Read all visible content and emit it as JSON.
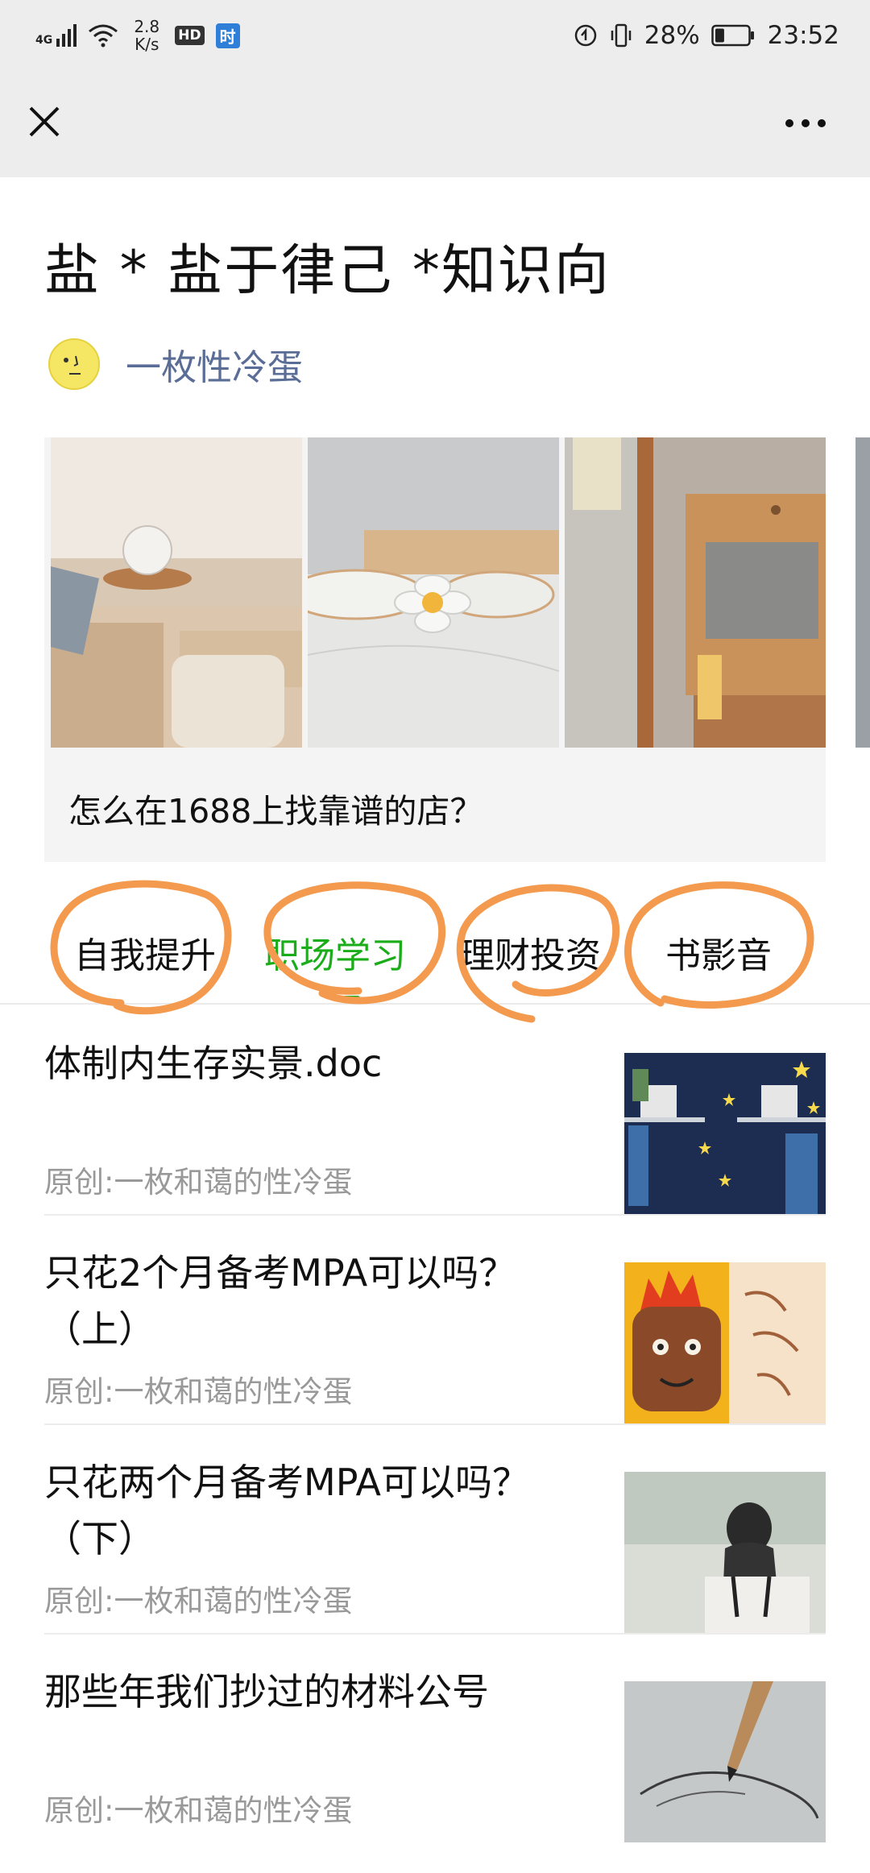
{
  "status_bar": {
    "signal": "4G",
    "net_speed_value": "2.8",
    "net_speed_unit": "K/s",
    "hd_badge": "HD",
    "app_badge": "时",
    "battery": "28%",
    "time": "23:52",
    "battery_level": 0.28
  },
  "nav": {
    "close_icon": "close-icon",
    "more_icon": "more-icon"
  },
  "page": {
    "title": "盐 * 盐于律己 *知识向",
    "author": "一枚性冷蛋"
  },
  "featured": {
    "caption": "怎么在1688上找靠谱的店？"
  },
  "tabs": [
    {
      "label": "自我提升",
      "active": false
    },
    {
      "label": "职场学习",
      "active": true
    },
    {
      "label": "理财投资",
      "active": false
    },
    {
      "label": "书影音",
      "active": false
    }
  ],
  "articles": [
    {
      "title": "体制内生存实景.doc",
      "meta": "原创:一枚和蔼的性冷蛋"
    },
    {
      "title": "只花2个月备考MPA可以吗？（上）",
      "meta": "原创:一枚和蔼的性冷蛋"
    },
    {
      "title": "只花两个月备考MPA可以吗？（下）",
      "meta": "原创:一枚和蔼的性冷蛋"
    },
    {
      "title": "那些年我们抄过的材料公号",
      "meta": "原创:一枚和蔼的性冷蛋"
    }
  ],
  "colors": {
    "accent_green": "#1aad19",
    "author_blue": "#5a6d96",
    "annotation_orange": "#f39a4e",
    "bar_gray": "#ededed"
  }
}
